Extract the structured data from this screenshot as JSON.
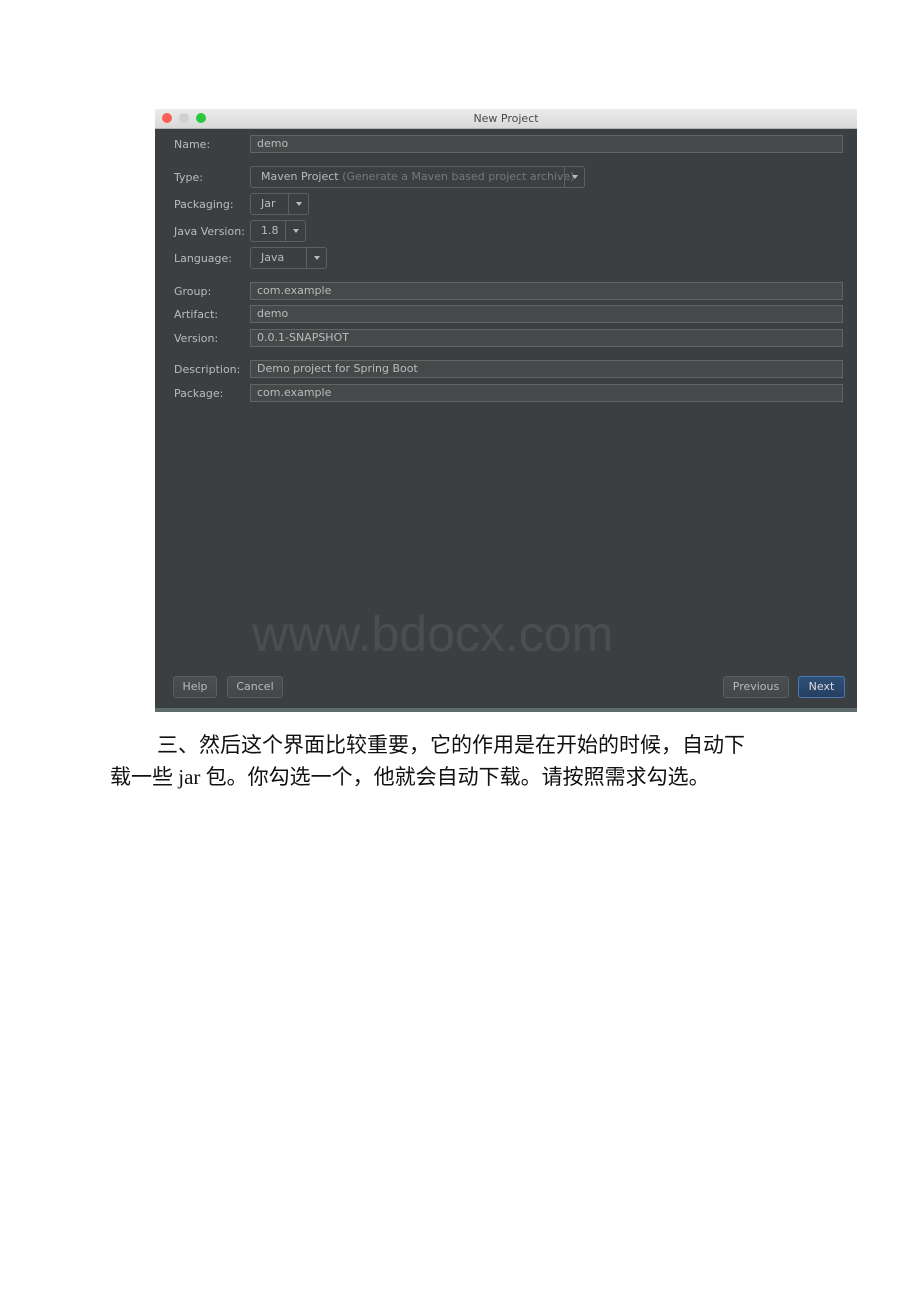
{
  "window": {
    "title": "New Project",
    "traffic_lights": [
      "close",
      "minimize",
      "maximize"
    ]
  },
  "form": {
    "name": {
      "label": "Name:",
      "value": "demo"
    },
    "type": {
      "label": "Type:",
      "value": "Maven Project",
      "hint": "(Generate a Maven based project archive)"
    },
    "packaging": {
      "label": "Packaging:",
      "value": "Jar"
    },
    "java_version": {
      "label": "Java Version:",
      "value": "1.8"
    },
    "language": {
      "label": "Language:",
      "value": "Java"
    },
    "group": {
      "label": "Group:",
      "value": "com.example"
    },
    "artifact": {
      "label": "Artifact:",
      "value": "demo"
    },
    "version": {
      "label": "Version:",
      "value": "0.0.1-SNAPSHOT"
    },
    "description": {
      "label": "Description:",
      "value": "Demo project for Spring Boot"
    },
    "package": {
      "label": "Package:",
      "value": "com.example"
    }
  },
  "watermark": "www.bdocx.com",
  "buttons": {
    "help": "Help",
    "cancel": "Cancel",
    "previous": "Previous",
    "next": "Next"
  },
  "colors": {
    "dialog_bg": "#3c3f41",
    "field_bg": "#45494a",
    "primary_button": "#2f4f78"
  },
  "document": {
    "line1": "三、然后这个界面比较重要，它的作用是在开始的时候，自动下",
    "line2": "载一些 jar 包。你勾选一个，他就会自动下载。请按照需求勾选。"
  }
}
